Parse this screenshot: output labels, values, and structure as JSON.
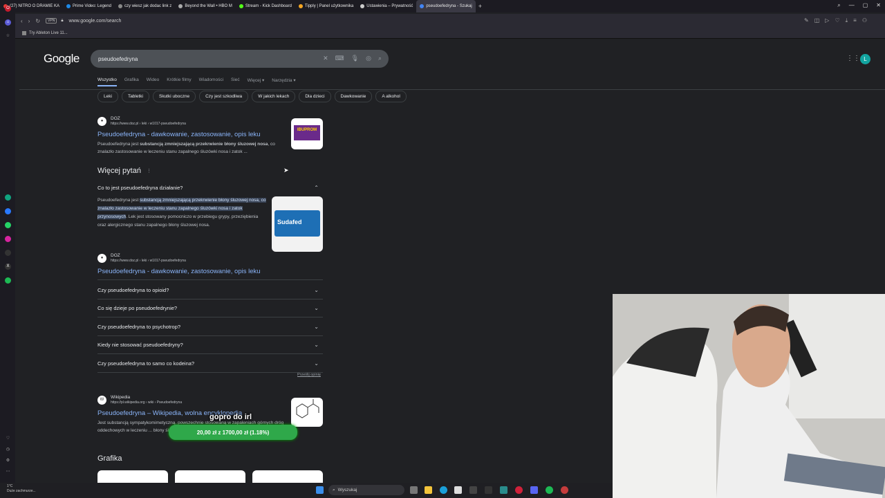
{
  "browser": {
    "tabs": [
      {
        "label": "(27) NITRO O DRAMIE KA",
        "color": "#e53935"
      },
      {
        "label": "Prime Video: Legend",
        "color": "#1e88e5"
      },
      {
        "label": "czy wiesz jak dodac link z",
        "color": "#888888"
      },
      {
        "label": "Beyond the Wall • HBO M",
        "color": "#aaaaaa"
      },
      {
        "label": "Stream - Kick Dashboard",
        "color": "#53fc18"
      },
      {
        "label": "Tipply | Panel użytkownika",
        "color": "#f5a623"
      },
      {
        "label": "Ustawienia – Prywatność",
        "color": "#cccccc"
      },
      {
        "label": "pseudoefedryna - Szukaj",
        "color": "#4285f4",
        "active": true
      }
    ],
    "url": "www.google.com/search",
    "vpn": "VPN",
    "bookmark": "Try Ableton Live 11..."
  },
  "google": {
    "logo": "Google",
    "query": "pseudoefedryna",
    "avatar_letter": "L",
    "tabs": [
      "Wszystko",
      "Grafika",
      "Wideo",
      "Krótkie filmy",
      "Wiadomości",
      "Sieć",
      "Więcej ▾",
      "Narzędzia ▾"
    ],
    "chips": [
      "Leki",
      "Tabletki",
      "Skutki uboczne",
      "Czy jest szkodliwa",
      "W jakich lekach",
      "Dla dzieci",
      "Dawkowanie",
      "A alkohol"
    ]
  },
  "result1": {
    "source": "DOZ",
    "url": "https://www.doz.pl › leki › w1017-pseudoefedryna",
    "title": "Pseudoefedryna - dawkowanie, zastosowanie, opis leku",
    "snippet_a": "Pseudoefedryna jest ",
    "snippet_b": "substancją zmniejszającą przekrwienie błony śluzowej nosa",
    "snippet_c": ", co znalazło zastosowanie w leczeniu stanu zapalnego śluzówki nosa i zatok ...",
    "thumb_text": "IBUPROM"
  },
  "paa": {
    "title": "Więcej pytań",
    "q1": "Co to jest pseudoefedryna działanie?",
    "answer_a": "Pseudoefedryna jest ",
    "answer_hl": "substancją zmniejszającą przekrwienie błony śluzowej nosa, co znalazło zastosowanie w leczeniu stanu zapalnego śluzówki nosa i zatok przynosowych",
    "answer_b": ". Lek jest stosowany pomocniczo w przebiegu grypy, przeziębienia oraz alergicznego stanu zapalnego błony śluzowej nosa.",
    "thumb_text": "Sudafed",
    "ans_source": "DOZ",
    "ans_url": "https://www.doz.pl › leki › w1017-pseudoefedryna",
    "ans_title": "Pseudoefedryna - dawkowanie, zastosowanie, opis leku",
    "questions": [
      "Czy pseudoefedryna to opioid?",
      "Co się dzieje po pseudoefedrynie?",
      "Czy pseudoefedryna to psychotrop?",
      "Kiedy nie stosować pseudoefedryny?",
      "Czy pseudoefedryna to samo co kodeina?"
    ],
    "feedback": "Prześlij opinię"
  },
  "result2": {
    "source": "Wikipedia",
    "url": "https://pl.wikipedia.org › wiki › Pseudoefedryna",
    "title": "Pseudoefedryna – Wikipedia, wolna encyklopedia",
    "snippet": "Jest substancją sympatykomimetyczną, powszechnie stosowaną w zapaleniach górnych dróg oddechowych w leczeniu ... błony śluzowej nosa, siarczanu."
  },
  "grafika": "Grafika",
  "overlay": {
    "text": "gopro do irl",
    "donation": "20,00 zł z 1700,00 zł (1.18%)"
  },
  "taskbar": {
    "weather_temp": "1°C",
    "weather_desc": "Duże zachmurze...",
    "search": "Wyszukaj"
  }
}
